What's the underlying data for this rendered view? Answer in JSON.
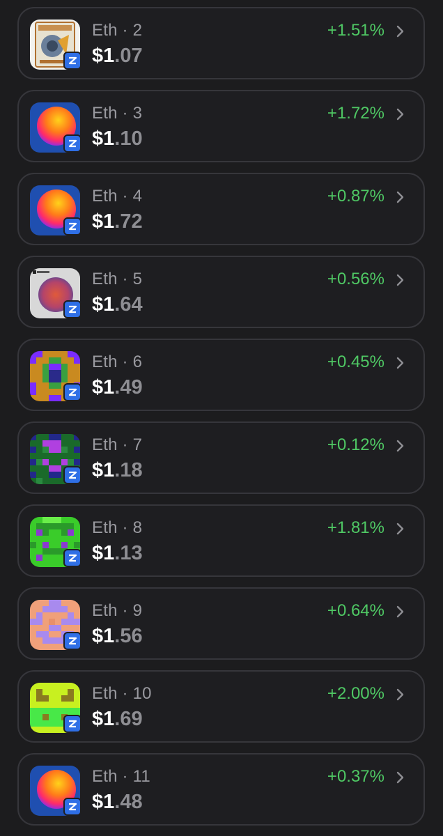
{
  "colors": {
    "positive": "#4fc864",
    "chain_badge": "#2f6fe6",
    "card_border": "#36363b",
    "background": "#1c1c1e"
  },
  "items": [
    {
      "network": "Eth",
      "separator": "·",
      "number": "2",
      "price_int": "$1",
      "price_dec": ".07",
      "change": "+1.51%",
      "thumbnail": "pack-artwork",
      "badge_icon": "zora-chain-icon"
    },
    {
      "network": "Eth",
      "separator": "·",
      "number": "3",
      "price_int": "$1",
      "price_dec": ".10",
      "change": "+1.72%",
      "thumbnail": "gradient-orb",
      "badge_icon": "zora-chain-icon"
    },
    {
      "network": "Eth",
      "separator": "·",
      "number": "4",
      "price_int": "$1",
      "price_dec": ".72",
      "change": "+0.87%",
      "thumbnail": "gradient-orb",
      "badge_icon": "zora-chain-icon"
    },
    {
      "network": "Eth",
      "separator": "·",
      "number": "5",
      "price_int": "$1",
      "price_dec": ".64",
      "change": "+0.56%",
      "thumbnail": "rainbow-orb",
      "badge_icon": "zora-chain-icon"
    },
    {
      "network": "Eth",
      "separator": "·",
      "number": "6",
      "price_int": "$1",
      "price_dec": ".49",
      "change": "+0.45%",
      "thumbnail": "pixel-purple-orange",
      "badge_icon": "zora-chain-icon"
    },
    {
      "network": "Eth",
      "separator": "·",
      "number": "7",
      "price_int": "$1",
      "price_dec": ".18",
      "change": "+0.12%",
      "thumbnail": "pixel-navy-green",
      "badge_icon": "zora-chain-icon"
    },
    {
      "network": "Eth",
      "separator": "·",
      "number": "8",
      "price_int": "$1",
      "price_dec": ".13",
      "change": "+1.81%",
      "thumbnail": "pixel-green-purple",
      "badge_icon": "zora-chain-icon"
    },
    {
      "network": "Eth",
      "separator": "·",
      "number": "9",
      "price_int": "$1",
      "price_dec": ".56",
      "change": "+0.64%",
      "thumbnail": "pixel-peach-lavender",
      "badge_icon": "zora-chain-icon"
    },
    {
      "network": "Eth",
      "separator": "·",
      "number": "10",
      "price_int": "$1",
      "price_dec": ".69",
      "change": "+2.00%",
      "thumbnail": "pixel-lime-yellow",
      "badge_icon": "zora-chain-icon"
    },
    {
      "network": "Eth",
      "separator": "·",
      "number": "11",
      "price_int": "$1",
      "price_dec": ".48",
      "change": "+0.37%",
      "thumbnail": "gradient-orb",
      "badge_icon": "zora-chain-icon"
    }
  ]
}
